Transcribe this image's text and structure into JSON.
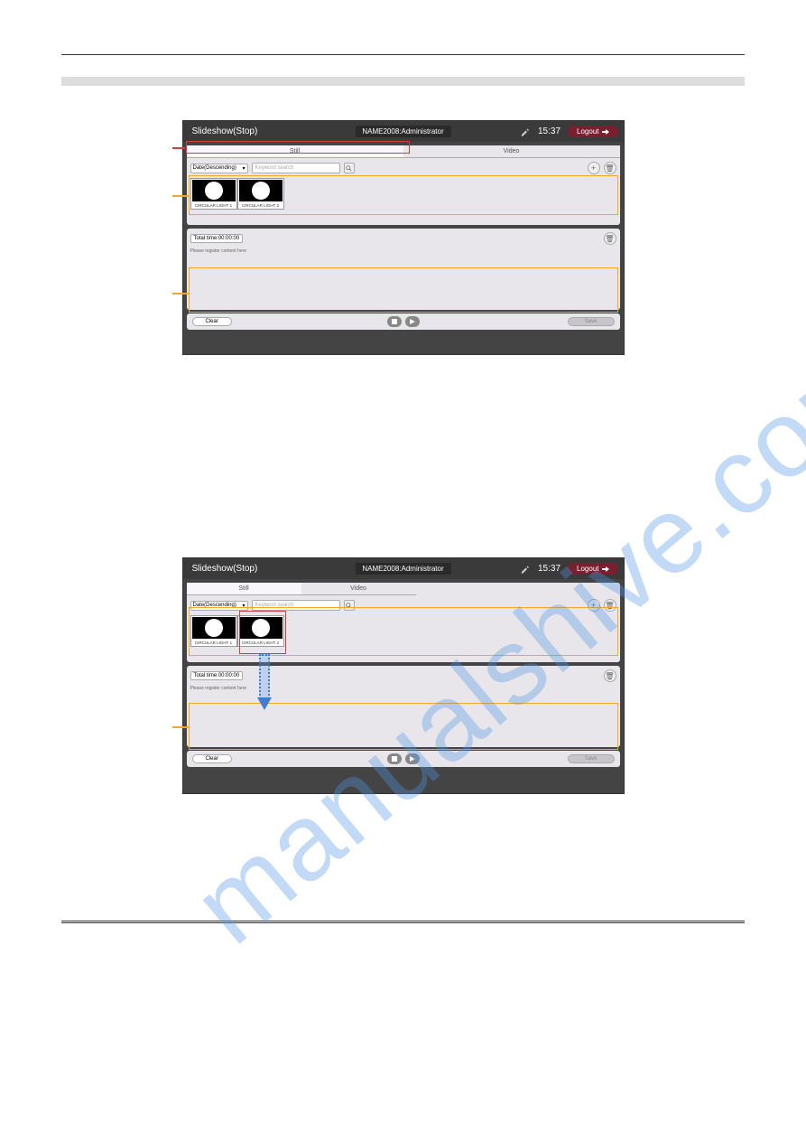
{
  "screenshots": [
    {
      "title": "Slideshow(Stop)",
      "user": "NAME2008:Administrator",
      "time": "15:37",
      "logout": "Logout",
      "tabs": [
        "Still",
        "Video"
      ],
      "sort": "Date(Descending)",
      "search_placeholder": "Keyword search",
      "thumbs": [
        {
          "label": "CIRCULAR LIGHT 1"
        },
        {
          "label": "CIRCULAR LIGHT 2"
        }
      ],
      "total_time": "Total time:00:00:00",
      "register_hint": "Please register content here",
      "clear": "Clear",
      "save": "Save"
    },
    {
      "title": "Slideshow(Stop)",
      "user": "NAME2008:Administrator",
      "time": "15:37",
      "logout": "Logout",
      "tabs": [
        "Still",
        "Video"
      ],
      "sort": "Date(Descending)",
      "search_placeholder": "Keyword search",
      "thumbs": [
        {
          "label": "CIRCULAR LIGHT 1"
        },
        {
          "label": "CIRCULAR LIGHT 2"
        }
      ],
      "total_time": "Total time:00:00:00",
      "register_hint": "Please register content here",
      "clear": "Clear",
      "save": "Save"
    }
  ],
  "watermark": "manualshive.com"
}
